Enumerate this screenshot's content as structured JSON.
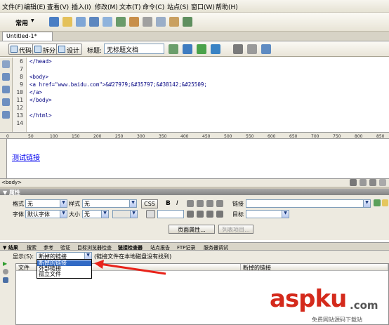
{
  "menubar": {
    "items": [
      "文件(F)",
      "编辑(E)",
      "查看(V)",
      "插入(I)",
      "修改(M)",
      "文本(T)",
      "命令(C)",
      "站点(S)",
      "窗口(W)",
      "帮助(H)"
    ]
  },
  "toolbar": {
    "category": "常用"
  },
  "document": {
    "tab": "Untitled-1*"
  },
  "doc_toolbar": {
    "code_label": "代码",
    "split_label": "拆分",
    "design_label": "设计",
    "title_label": "标题:",
    "title_value": "无标题文档"
  },
  "code": {
    "lines": [
      {
        "num": "6",
        "text": "</head>"
      },
      {
        "num": "7",
        "text": ""
      },
      {
        "num": "8",
        "text": "<body>"
      },
      {
        "num": "9",
        "text": "<a href=\"www.baidu.com\">&#27979;&#35797;&#38142;&#25509;"
      },
      {
        "num": "10",
        "text": "</a>"
      },
      {
        "num": "11",
        "text": "</body>"
      },
      {
        "num": "12",
        "text": ""
      },
      {
        "num": "13",
        "text": "</html>"
      },
      {
        "num": "14",
        "text": ""
      }
    ]
  },
  "ruler": {
    "ticks": [
      "0",
      "50",
      "100",
      "150",
      "200",
      "250",
      "300",
      "350",
      "400",
      "450",
      "500",
      "550",
      "600",
      "650",
      "700",
      "750",
      "800",
      "850"
    ]
  },
  "design": {
    "link_text": "测试链接"
  },
  "status": {
    "tag": "<body>"
  },
  "properties": {
    "header": "▼ 属性",
    "format_label": "格式",
    "format_value": "无",
    "style_label": "样式",
    "style_value": "无",
    "css_label": "CSS",
    "link_label": "链接",
    "font_label": "字体",
    "font_value": "默认字体",
    "size_label": "大小",
    "size_value": "无",
    "target_label": "目标",
    "page_props_label": "页面属性...",
    "list_item_label": "列表项目..."
  },
  "results": {
    "tabs": [
      "▼ 结果",
      "搜索",
      "参考",
      "验证",
      "目标浏览器检查",
      "链接检查器",
      "站点报告",
      "FTP记录",
      "服务器调试"
    ],
    "show_label": "显示(S):",
    "show_value": "断掉的链接",
    "hint": "(链接文件在本地磁盘没有找到)",
    "columns": [
      "文件",
      "断掉的链接"
    ],
    "options": [
      "断掉的链接",
      "外部链接",
      "孤立文件"
    ]
  },
  "watermark": {
    "brand": "aspku",
    "tld": ".com",
    "tagline": "免费网站源码下载站"
  }
}
